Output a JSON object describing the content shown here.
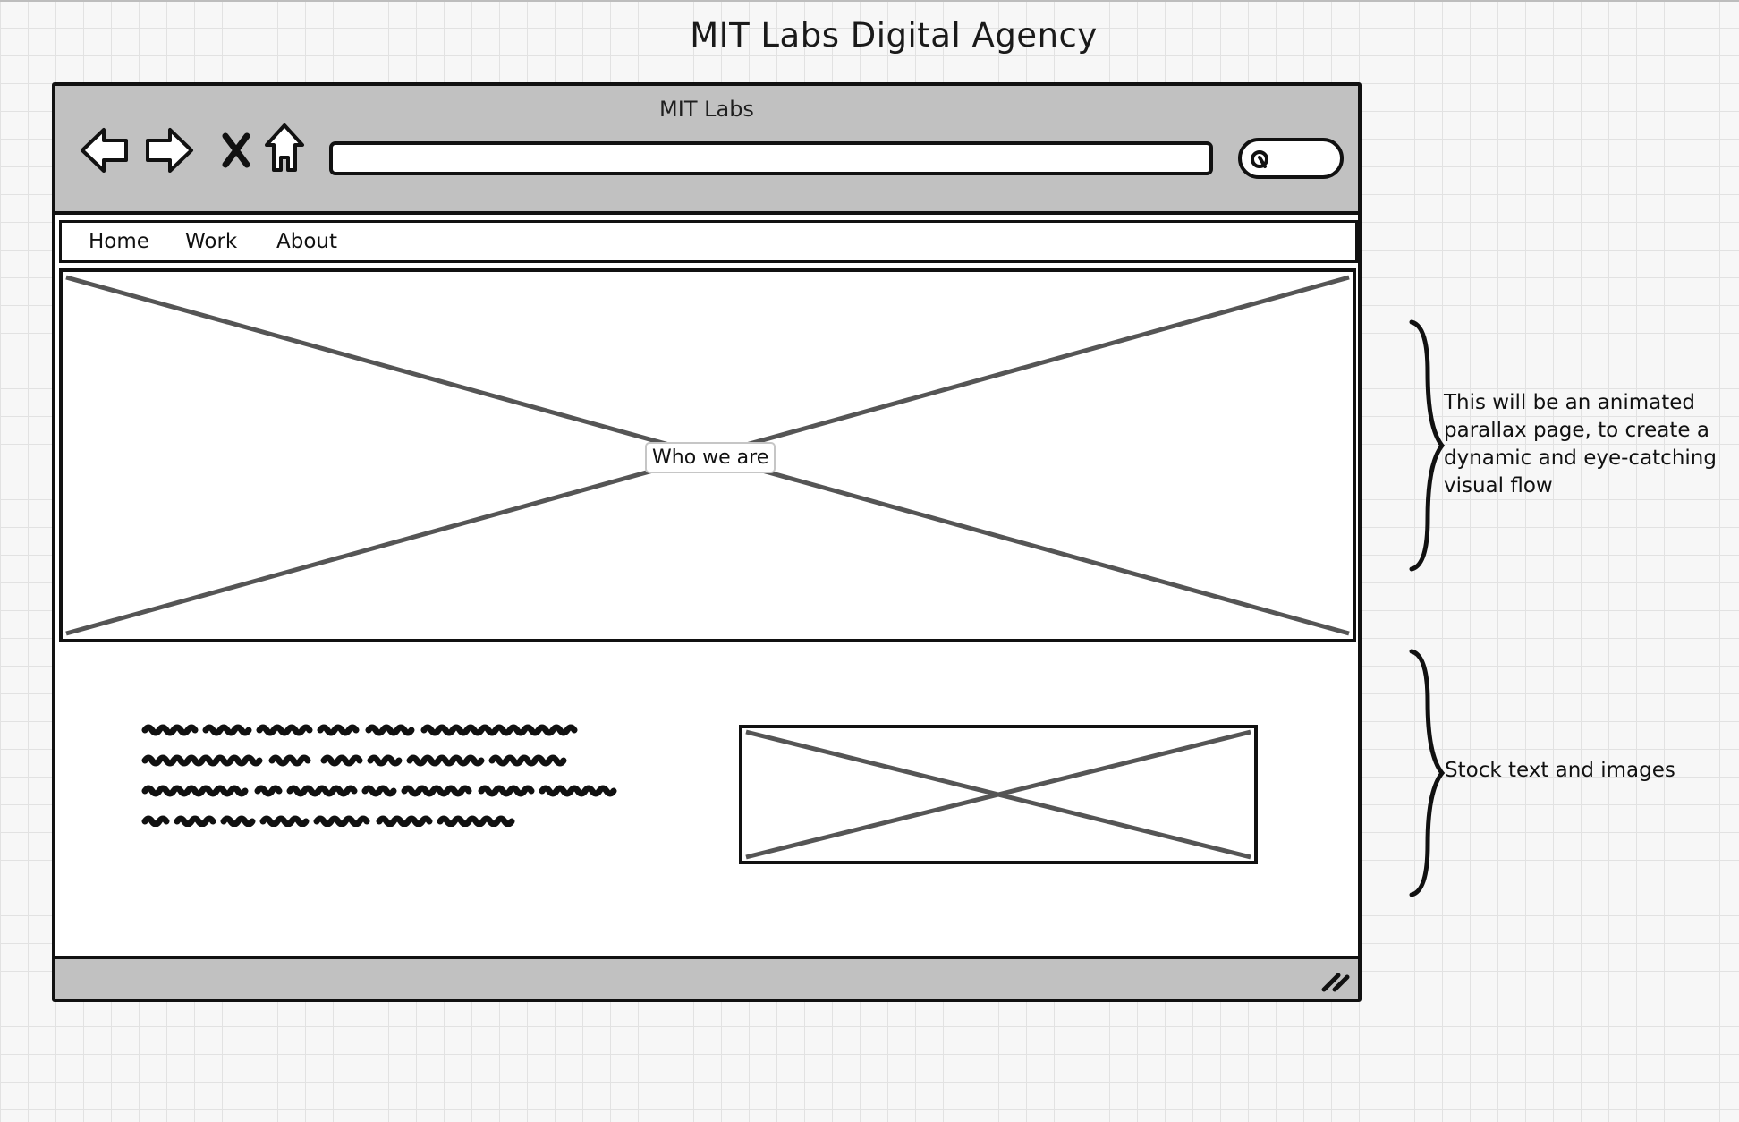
{
  "page": {
    "title": "MIT Labs Digital Agency"
  },
  "browser": {
    "window_title": "MIT Labs",
    "toolbar": {
      "icons": [
        "back-arrow-icon",
        "forward-arrow-icon",
        "close-icon",
        "home-icon"
      ],
      "url_value": "",
      "search_icon": "search-icon"
    }
  },
  "site": {
    "menu": [
      "Home",
      "Work",
      "About"
    ],
    "hero": {
      "placeholder": "image-placeholder",
      "label": "Who we are"
    },
    "content": {
      "text_block": "scribbled placeholder text",
      "image": "image-placeholder"
    }
  },
  "annotations": [
    {
      "text": "This will be an animated\nparallax page, to create a\ndynamic and eye-catching\nvisual flow"
    },
    {
      "text": "Stock text and images"
    }
  ],
  "colors": {
    "toolbar_gray": "#c1c1c1",
    "ink": "#111111",
    "placeholder_line": "#555555",
    "grid": "#e2e2e2"
  }
}
